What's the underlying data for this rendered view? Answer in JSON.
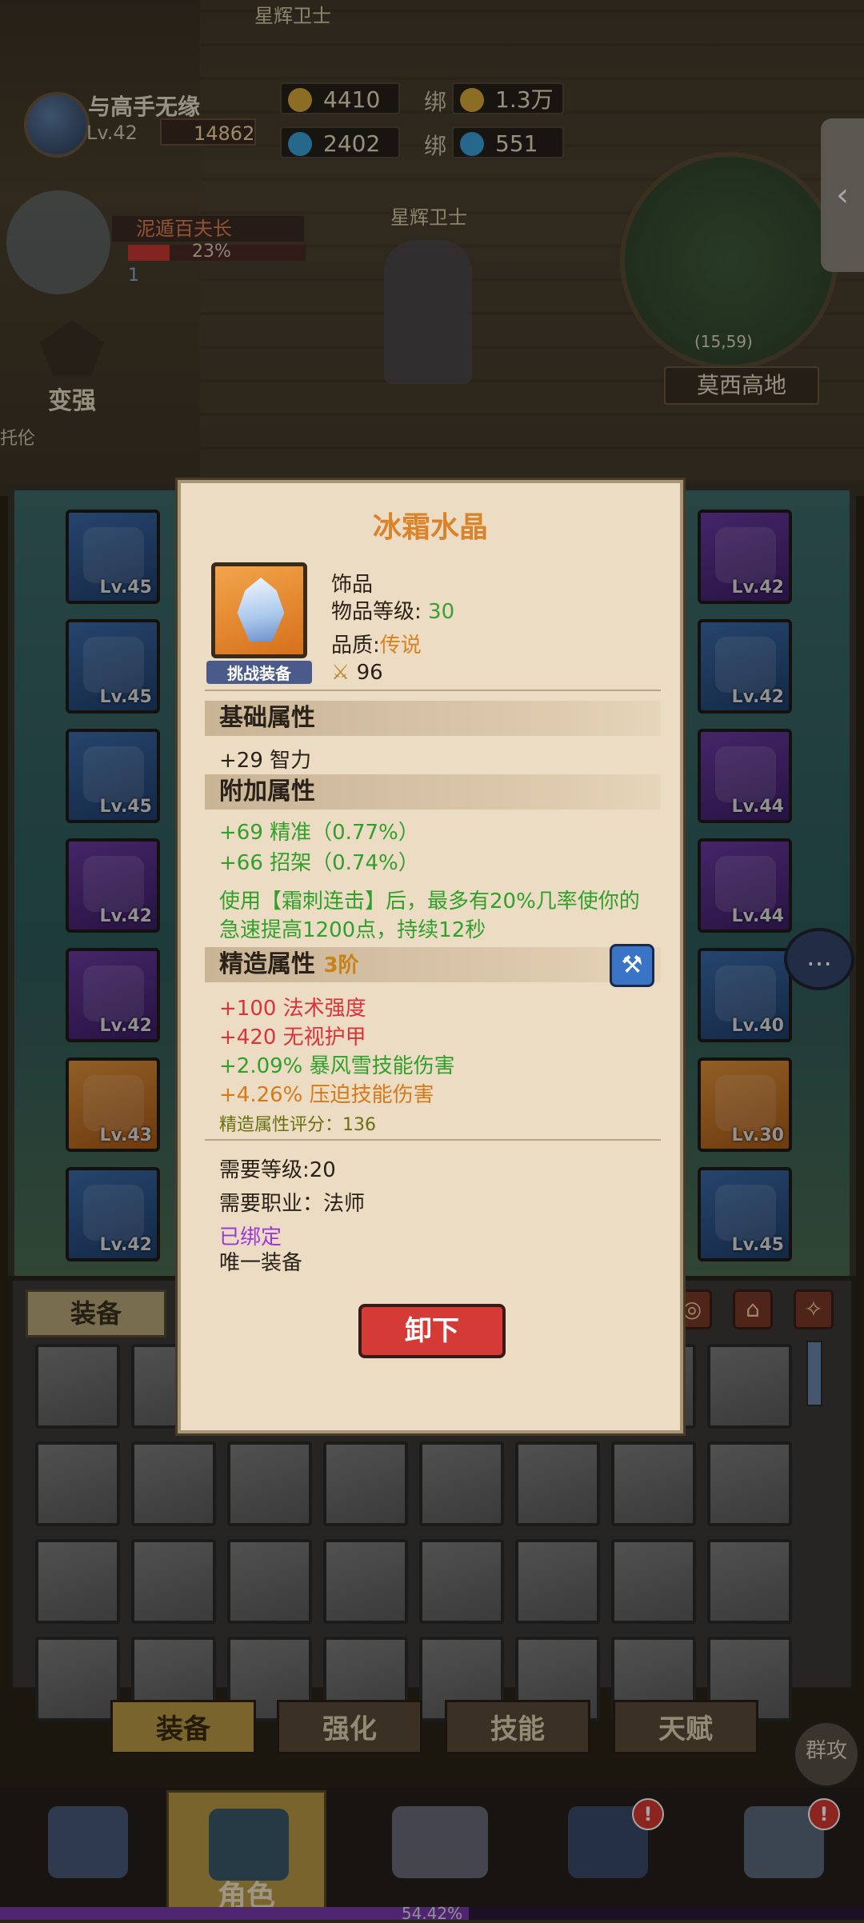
{
  "hud": {
    "player_name": "与高手无缘",
    "level": "Lv.42",
    "combat_power": "14862",
    "gold": "4410",
    "gems": "2402",
    "bound_label": "绑",
    "bound_gold": "1.3万",
    "bound_gems": "551",
    "top_npc": "星辉卫士",
    "npc_name": "星辉卫士",
    "quest_title": "泥遁百夫长",
    "quest_progress": "23%",
    "quest_count": "1",
    "strengthen_label": "变强",
    "map_coord": "(15,59)",
    "map_name": "莫西高地",
    "side_text": "托伦"
  },
  "equipment_left": [
    {
      "level": "Lv.45",
      "rarity": "blue"
    },
    {
      "level": "Lv.45",
      "rarity": "blue"
    },
    {
      "level": "Lv.45",
      "rarity": "blue"
    },
    {
      "level": "Lv.42",
      "rarity": "purple"
    },
    {
      "level": "Lv.42",
      "rarity": "purple"
    },
    {
      "level": "Lv.43",
      "rarity": "orange"
    },
    {
      "level": "Lv.42",
      "rarity": "blue"
    }
  ],
  "equipment_right": [
    {
      "level": "Lv.42",
      "rarity": "purple"
    },
    {
      "level": "Lv.42",
      "rarity": "blue"
    },
    {
      "level": "Lv.44",
      "rarity": "purple"
    },
    {
      "level": "Lv.44",
      "rarity": "purple"
    },
    {
      "level": "Lv.40",
      "rarity": "blue"
    },
    {
      "level": "Lv.30",
      "rarity": "orange"
    },
    {
      "level": "Lv.45",
      "rarity": "blue"
    }
  ],
  "inventory": {
    "tab_label": "装备"
  },
  "sub_tabs": [
    "装备",
    "强化",
    "技能",
    "天赋"
  ],
  "group_attack": "群攻",
  "nav": {
    "role_label": "角色",
    "badge": "!"
  },
  "exp_percent": "54.42%",
  "tooltip": {
    "title": "冰霜水晶",
    "type": "饰品",
    "item_level_label": "物品等级:",
    "item_level": "30",
    "quality_label": "品质:",
    "quality": "传说",
    "score": "96",
    "challenge_tag": "挑战装备",
    "base_header": "基础属性",
    "base_stat": "+29 智力",
    "extra_header": "附加属性",
    "extra_stat_1": "+69 精准（0.77%）",
    "extra_stat_2": "+66 招架（0.74%）",
    "effect_line_1": "使用【霜刺连击】后，最多有20%几率使你的",
    "effect_line_2": "急速提高1200点，持续12秒",
    "forge_header": "精造属性",
    "forge_tier": "3阶",
    "forge_stat_1": "+100 法术强度",
    "forge_stat_2": "+420 无视护甲",
    "forge_stat_3": "+2.09% 暴风雪技能伤害",
    "forge_stat_4": "+4.26% 压迫技能伤害",
    "forge_score": "精造属性评分：136",
    "req_level": "需要等级:20",
    "req_class": "需要职业：法师",
    "bound": "已绑定",
    "unique": "唯一装备",
    "unequip_button": "卸下"
  },
  "colors": {
    "accent": "#d9832a",
    "green": "#31a02a",
    "red": "#d9343a",
    "purple": "#9a3ad8"
  }
}
